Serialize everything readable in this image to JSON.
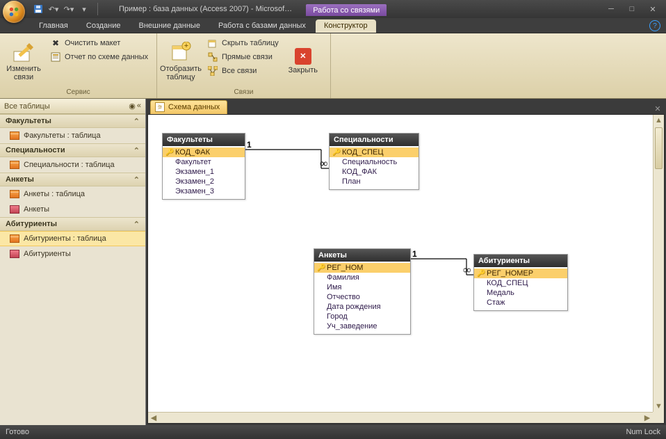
{
  "title": "Пример : база данных (Access 2007) - Microsof…",
  "contextual_tab_group": "Работа со связями",
  "tabs": {
    "home": "Главная",
    "create": "Создание",
    "external": "Внешние данные",
    "dbtools": "Работа с базами данных",
    "designer": "Конструктор"
  },
  "ribbon": {
    "edit_relations": "Изменить\nсвязи",
    "clear_layout": "Очистить макет",
    "schema_report": "Отчет по схеме данных",
    "group_service": "Сервис",
    "show_table": "Отобразить\nтаблицу",
    "hide_table": "Скрыть таблицу",
    "direct_relations": "Прямые связи",
    "all_relations": "Все связи",
    "group_relations": "Связи",
    "close": "Закрыть"
  },
  "navpane": {
    "header": "Все таблицы",
    "groups": [
      {
        "title": "Факультеты",
        "items": [
          {
            "icon": "table",
            "label": "Факультеты : таблица"
          }
        ]
      },
      {
        "title": "Специальности",
        "items": [
          {
            "icon": "table",
            "label": "Специальности : таблица"
          }
        ]
      },
      {
        "title": "Анкеты",
        "items": [
          {
            "icon": "table",
            "label": "Анкеты : таблица"
          },
          {
            "icon": "form",
            "label": "Анкеты"
          }
        ]
      },
      {
        "title": "Абитуриенты",
        "items": [
          {
            "icon": "table",
            "label": "Абитуриенты : таблица",
            "selected": true
          },
          {
            "icon": "form",
            "label": "Абитуриенты"
          }
        ]
      }
    ]
  },
  "doc_tab": "Схема данных",
  "tables": {
    "fac": {
      "title": "Факультеты",
      "pk": "КОД_ФАК",
      "fields": [
        "Факультет",
        "Экзамен_1",
        "Экзамен_2",
        "Экзамен_3"
      ]
    },
    "spec": {
      "title": "Специальности",
      "pk": "КОД_СПЕЦ",
      "fields": [
        "Специальность",
        "КОД_ФАК",
        "План"
      ]
    },
    "ank": {
      "title": "Анкеты",
      "pk": "РЕГ_НОМ",
      "fields": [
        "Фамилия",
        "Имя",
        "Отчество",
        "Дата рождения",
        "Город",
        "Уч_заведение"
      ]
    },
    "abi": {
      "title": "Абитуриенты",
      "pk": "РЕГ_НОМЕР",
      "fields": [
        "КОД_СПЕЦ",
        "Медаль",
        "Стаж"
      ]
    }
  },
  "rel_labels": {
    "one": "1",
    "many": "∞"
  },
  "status": {
    "left": "Готово",
    "right": "Num Lock"
  }
}
